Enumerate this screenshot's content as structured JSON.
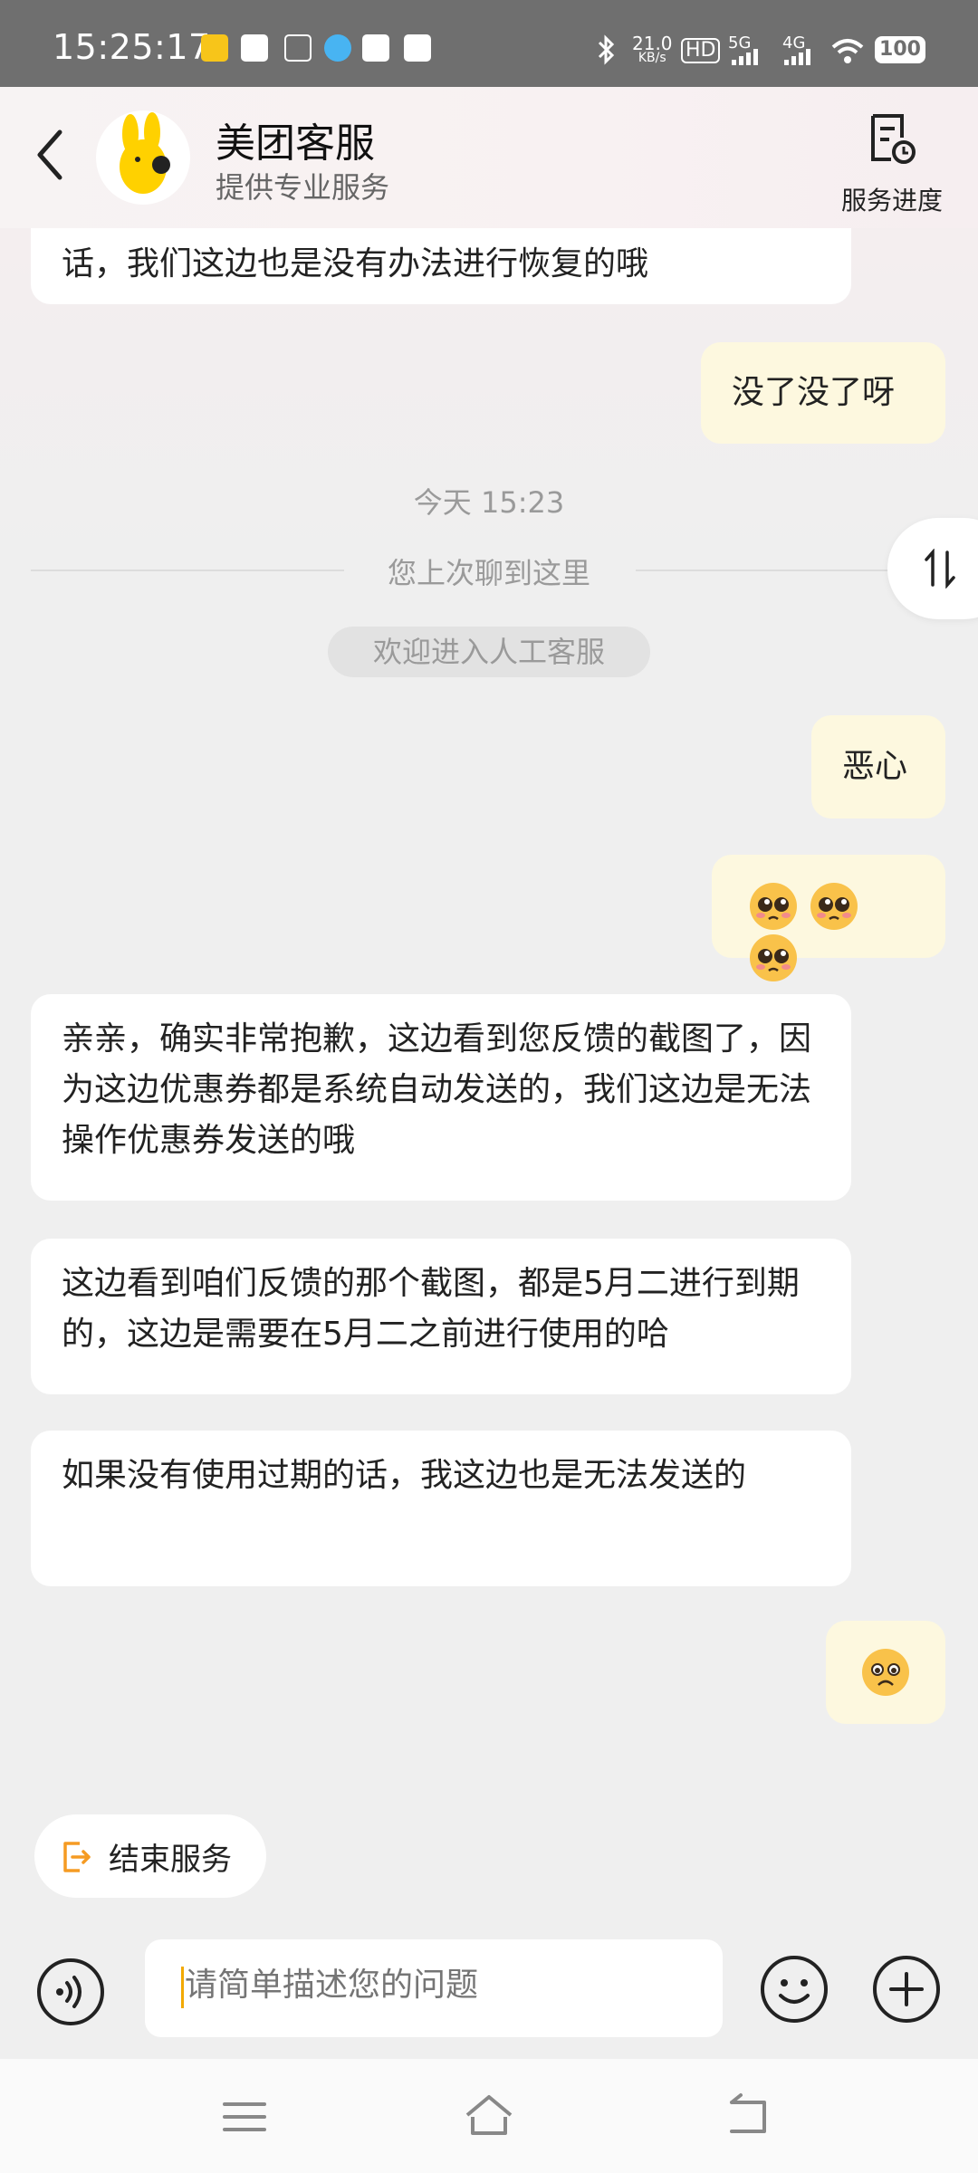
{
  "status_bar": {
    "time": "15:25:17",
    "net_speed": "21.0",
    "net_unit": "KB/s",
    "hd": "HD",
    "sim1": "5G",
    "sim2": "4G",
    "battery": "100"
  },
  "header": {
    "title": "美团客服",
    "subtitle": "提供专业服务",
    "progress_label": "服务进度"
  },
  "chat": {
    "msg_partial": "话，我们这边也是没有办法进行恢复的哦",
    "msg_user_1": "没了没了呀",
    "timestamp": "今天 15:23",
    "divider_text": "您上次聊到这里",
    "system_pill": "欢迎进入人工客服",
    "msg_user_2": "恶心",
    "msg_agent_1": "亲亲，确实非常抱歉，这边看到您反馈的截图了，因为这边优惠券都是系统自动发送的，我们这边是无法操作优惠券发送的哦",
    "msg_agent_2": "这边看到咱们反馈的那个截图，都是5月二进行到期的，这边是需要在5月二之前进行使用的哈",
    "msg_agent_3": "如果没有使用过期的话，我这边也是无法发送的"
  },
  "bottom": {
    "end_service": "结束服务",
    "input_placeholder": "请简单描述您的问题"
  },
  "colors": {
    "accent": "#f59b23",
    "user_bubble": "#fdf8df",
    "agent_bubble": "#ffffff"
  }
}
